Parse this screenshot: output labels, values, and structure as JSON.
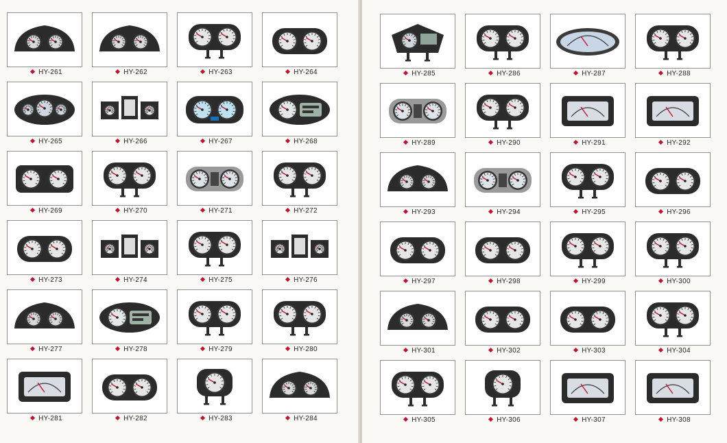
{
  "pages": [
    {
      "side": "left",
      "items": [
        {
          "code": "HY-261",
          "style": "wide"
        },
        {
          "code": "HY-262",
          "style": "wide"
        },
        {
          "code": "HY-263",
          "style": "twin-bracket"
        },
        {
          "code": "HY-264",
          "style": "twin"
        },
        {
          "code": "HY-265",
          "style": "triple"
        },
        {
          "code": "HY-266",
          "style": "box-triple"
        },
        {
          "code": "HY-267",
          "style": "blue"
        },
        {
          "code": "HY-268",
          "style": "digital"
        },
        {
          "code": "HY-269",
          "style": "twin-square"
        },
        {
          "code": "HY-270",
          "style": "twin-bracket"
        },
        {
          "code": "HY-271",
          "style": "twin-chrome"
        },
        {
          "code": "HY-272",
          "style": "twin-bracket"
        },
        {
          "code": "HY-273",
          "style": "twin"
        },
        {
          "code": "HY-274",
          "style": "box-triple"
        },
        {
          "code": "HY-275",
          "style": "twin-bracket"
        },
        {
          "code": "HY-276",
          "style": "box-triple"
        },
        {
          "code": "HY-277",
          "style": "wide"
        },
        {
          "code": "HY-278",
          "style": "digital"
        },
        {
          "code": "HY-279",
          "style": "twin-bracket"
        },
        {
          "code": "HY-280",
          "style": "twin-bracket"
        },
        {
          "code": "HY-281",
          "style": "box-single"
        },
        {
          "code": "HY-282",
          "style": "twin"
        },
        {
          "code": "HY-283",
          "style": "single-bracket"
        },
        {
          "code": "HY-284",
          "style": "wide"
        }
      ]
    },
    {
      "side": "right",
      "items": [
        {
          "code": "HY-285",
          "style": "digital-bracket"
        },
        {
          "code": "HY-286",
          "style": "twin-bracket"
        },
        {
          "code": "HY-287",
          "style": "oval"
        },
        {
          "code": "HY-288",
          "style": "twin-bracket"
        },
        {
          "code": "HY-289",
          "style": "twin-chrome"
        },
        {
          "code": "HY-290",
          "style": "twin-bracket"
        },
        {
          "code": "HY-291",
          "style": "box-single"
        },
        {
          "code": "HY-292",
          "style": "box-single"
        },
        {
          "code": "HY-293",
          "style": "wide"
        },
        {
          "code": "HY-294",
          "style": "twin-chrome"
        },
        {
          "code": "HY-295",
          "style": "twin-bracket"
        },
        {
          "code": "HY-296",
          "style": "twin"
        },
        {
          "code": "HY-297",
          "style": "twin"
        },
        {
          "code": "HY-298",
          "style": "twin"
        },
        {
          "code": "HY-299",
          "style": "twin-bracket"
        },
        {
          "code": "HY-300",
          "style": "twin-bracket"
        },
        {
          "code": "HY-301",
          "style": "wide"
        },
        {
          "code": "HY-302",
          "style": "twin"
        },
        {
          "code": "HY-303",
          "style": "twin"
        },
        {
          "code": "HY-304",
          "style": "twin-bracket"
        },
        {
          "code": "HY-305",
          "style": "twin-bracket"
        },
        {
          "code": "HY-306",
          "style": "single-bracket"
        },
        {
          "code": "HY-307",
          "style": "box-single"
        },
        {
          "code": "HY-308",
          "style": "box-single"
        }
      ]
    }
  ],
  "colors": {
    "bullet": "#c8102e",
    "frame": "#8f8f8f",
    "housing": "#2b2b2b",
    "dial": "#e9e9e9"
  }
}
